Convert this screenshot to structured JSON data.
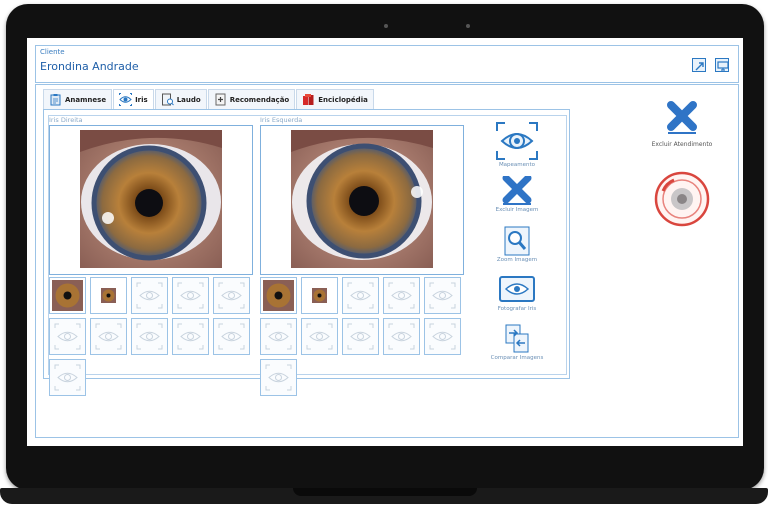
{
  "client": {
    "label": "Cliente",
    "name": "Erondina Andrade"
  },
  "header_icons": [
    "expand-window-icon",
    "monitor-icon"
  ],
  "tabs": [
    {
      "label": "Anamnese",
      "icon": "clipboard-icon"
    },
    {
      "label": "Iris",
      "icon": "iris-eye-icon",
      "active": true
    },
    {
      "label": "Laudo",
      "icon": "report-icon"
    },
    {
      "label": "Recomendação",
      "icon": "prescription-icon"
    },
    {
      "label": "Enciclopédia",
      "icon": "books-icon"
    }
  ],
  "eyes": {
    "right": {
      "label": "Iris Direita"
    },
    "left": {
      "label": "Iris Esquerda"
    }
  },
  "tools": [
    {
      "label": "Mapeamento",
      "icon": "eye-map-icon"
    },
    {
      "label": "Excluir Imagem",
      "icon": "delete-x-icon"
    },
    {
      "label": "Zoom Imagem",
      "icon": "magnifier-icon"
    },
    {
      "label": "Fotografar Iris",
      "icon": "camera-eye-icon"
    },
    {
      "label": "Comparar Imagens",
      "icon": "compare-icon"
    }
  ],
  "side_actions": [
    {
      "label": "Excluir Atendimento",
      "icon": "delete-x-icon"
    },
    {
      "label": "",
      "icon": "iris-seal-icon"
    }
  ],
  "colors": {
    "accent": "#2b78c2",
    "border": "#9cc3e6",
    "iris_brown": "#a06a2a",
    "delete_blue": "#2f74c6",
    "seal_red": "#d9463e"
  }
}
